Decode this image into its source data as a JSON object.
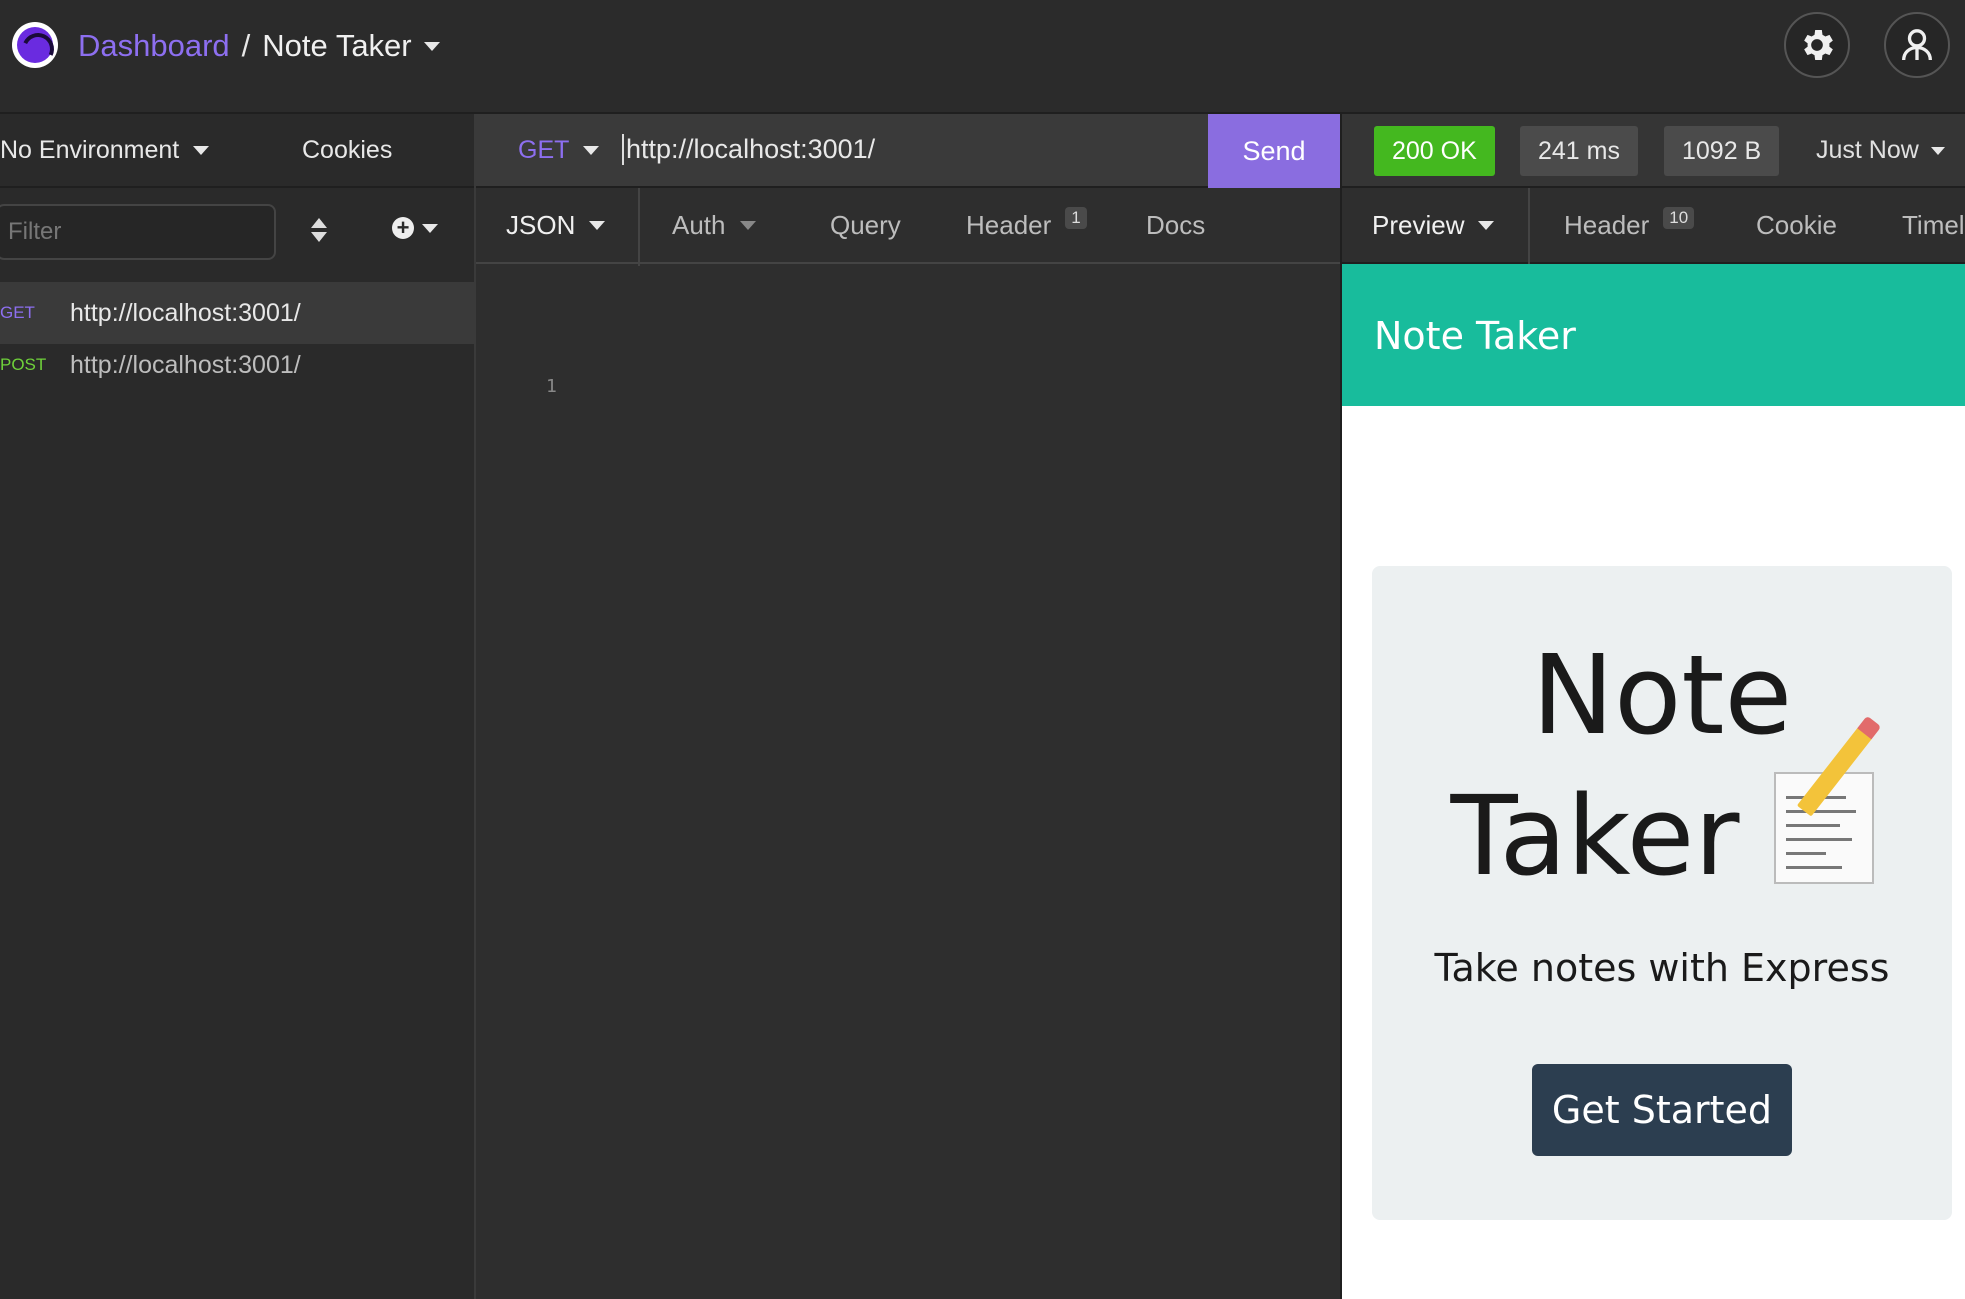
{
  "header": {
    "breadcrumb_root": "Dashboard",
    "breadcrumb_sep": "/",
    "breadcrumb_current": "Note Taker",
    "settings_icon": "gear-icon",
    "account_icon": "user-icon"
  },
  "sidebar": {
    "environment": "No Environment",
    "cookies": "Cookies",
    "filter_placeholder": "Filter",
    "requests": [
      {
        "method": "GET",
        "url": "http://localhost:3001/"
      },
      {
        "method": "POST",
        "url": "http://localhost:3001/"
      }
    ]
  },
  "request": {
    "method": "GET",
    "url": "http://localhost:3001/",
    "send_label": "Send",
    "tabs": {
      "body": "JSON",
      "auth": "Auth",
      "query": "Query",
      "header": "Header",
      "header_count": "1",
      "docs": "Docs"
    },
    "line_number": "1"
  },
  "response": {
    "status": "200 OK",
    "time": "241 ms",
    "size": "1092 B",
    "when": "Just Now",
    "tabs": {
      "preview": "Preview",
      "header": "Header",
      "header_count": "10",
      "cookie": "Cookie",
      "timeline": "Timel"
    },
    "preview": {
      "brand": "Note Taker",
      "title_line1": "Note",
      "title_line2": "Taker",
      "subtitle": "Take notes with Express",
      "button": "Get Started"
    }
  },
  "colors": {
    "accent": "#8a6de0",
    "status_ok": "#44b81f",
    "preview_header": "#18bc9c",
    "preview_button": "#2c3e50"
  }
}
